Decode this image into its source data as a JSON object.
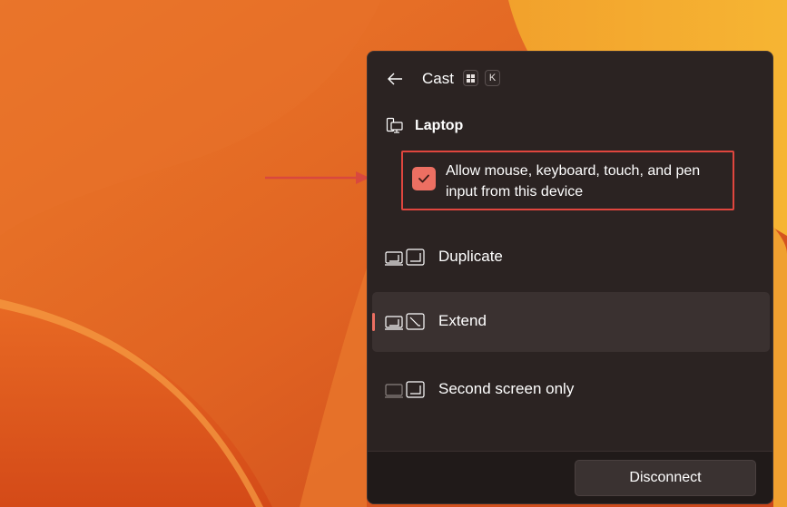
{
  "window": {
    "title": "Cast",
    "shortcut_keys": [
      "⊞",
      "K"
    ]
  },
  "device": {
    "name": "Laptop",
    "icon": "laptop-desktop-icon"
  },
  "input_option": {
    "label": "Allow mouse, keyboard, touch, and pen input from this device",
    "checked": true
  },
  "projection_modes": [
    {
      "label": "Duplicate",
      "icon": "duplicate-display-icon",
      "selected": false
    },
    {
      "label": "Extend",
      "icon": "extend-display-icon",
      "selected": true
    },
    {
      "label": "Second screen only",
      "icon": "second-screen-only-icon",
      "selected": false
    }
  ],
  "footer": {
    "disconnect_label": "Disconnect"
  },
  "colors": {
    "accent": "#ec6f62",
    "highlight_box": "#e0463e",
    "panel_bg": "#2b2322"
  }
}
